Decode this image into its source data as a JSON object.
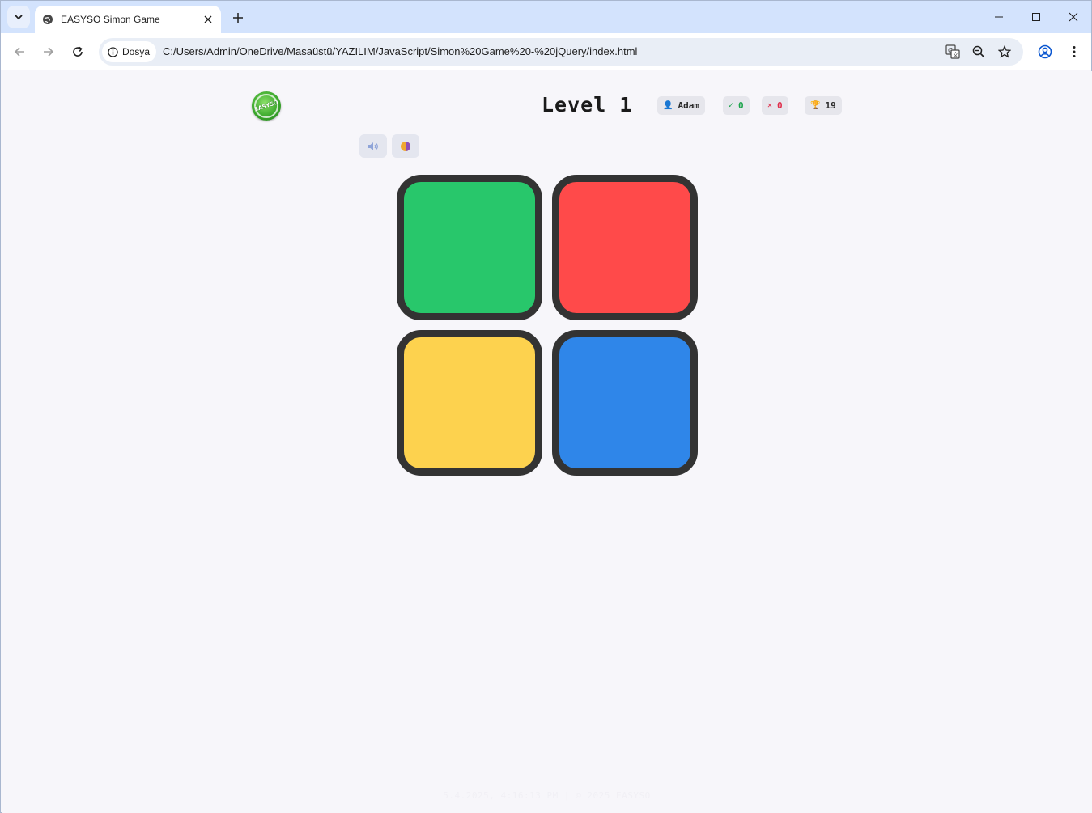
{
  "browser": {
    "tab_title": "EASYSO Simon Game",
    "site_chip_label": "Dosya",
    "url": "C:/Users/Admin/OneDrive/Masaüstü/YAZILIM/JavaScript/Simon%20Game%20-%20jQuery/index.html"
  },
  "game": {
    "logo_text": "EASYSO",
    "level_label": "Level 1",
    "player": {
      "icon": "👤",
      "name": "Adam"
    },
    "correct": {
      "icon": "✓",
      "value": "0"
    },
    "wrong": {
      "icon": "✕",
      "value": "0"
    },
    "best": {
      "icon": "🏆",
      "value": "19"
    },
    "controls": [
      {
        "name": "sound-toggle",
        "icon": "speaker-icon"
      },
      {
        "name": "theme-toggle",
        "icon": "theme-icon"
      }
    ],
    "pads": [
      {
        "name": "green",
        "color": "#28c76b"
      },
      {
        "name": "red",
        "color": "#ff4a4a"
      },
      {
        "name": "yellow",
        "color": "#fdd24e"
      },
      {
        "name": "blue",
        "color": "#2f86e9"
      }
    ],
    "footer": "5.4.2025, 4:16:13 PM | © 2025 EASYSO"
  }
}
